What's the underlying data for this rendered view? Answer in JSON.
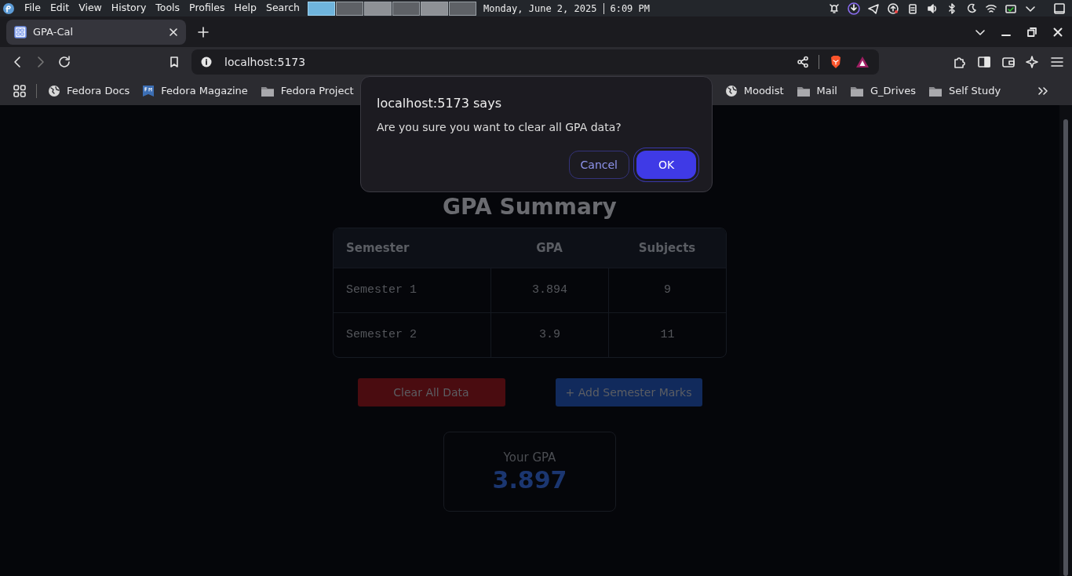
{
  "system_bar": {
    "menu": [
      "File",
      "Edit",
      "View",
      "History",
      "Tools",
      "Profiles",
      "Help",
      "Search"
    ],
    "workspaces": [
      {
        "selected": true
      },
      {
        "selected": false
      },
      {
        "selected": false
      },
      {
        "selected": false
      },
      {
        "selected": false
      },
      {
        "selected": false
      }
    ],
    "date": "Monday, June 2, 2025",
    "time": "6:09 PM"
  },
  "tabs": [
    {
      "title": "GPA-Cal",
      "selected": true
    }
  ],
  "address_bar": {
    "url": "localhost:5173"
  },
  "bookmarks": [
    {
      "label": "Fedora Docs",
      "kind": "site"
    },
    {
      "label": "Fedora Magazine",
      "kind": "magazine"
    },
    {
      "label": "Fedora Project",
      "kind": "folder"
    },
    {
      "label": "Moodist",
      "kind": "site"
    },
    {
      "label": "Mail",
      "kind": "folder"
    },
    {
      "label": "G_Drives",
      "kind": "folder"
    },
    {
      "label": "Self Study",
      "kind": "folder"
    }
  ],
  "page": {
    "heading": "GPA Summary",
    "table": {
      "columns": [
        "Semester",
        "GPA",
        "Subjects"
      ],
      "rows": [
        [
          "Semester 1",
          "3.894",
          "9"
        ],
        [
          "Semester 2",
          "3.9",
          "11"
        ]
      ]
    },
    "buttons": [
      {
        "label": "Clear All Data",
        "kind": "danger"
      },
      {
        "label": "+ Add Semester Marks",
        "kind": "primary"
      }
    ],
    "result": {
      "label": "Your GPA",
      "value": "3.897"
    }
  },
  "dialog": {
    "title": "localhost:5173 says",
    "message": "Are you sure you want to clear all GPA data?",
    "buttons": [
      {
        "label": "Cancel",
        "kind": "secondary"
      },
      {
        "label": "OK",
        "kind": "primary"
      }
    ]
  }
}
